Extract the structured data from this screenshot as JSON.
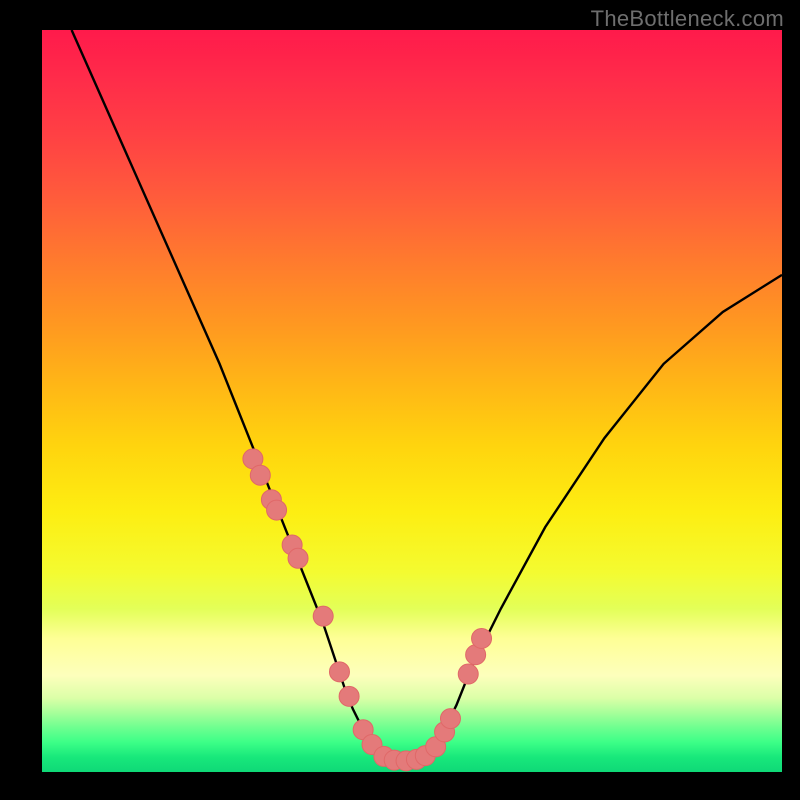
{
  "watermark": "TheBottleneck.com",
  "colors": {
    "background": "#000000",
    "curve": "#000000",
    "dots": "#e47a7a",
    "dot_stroke": "#e06868"
  },
  "chart_data": {
    "type": "line",
    "title": "",
    "xlabel": "",
    "ylabel": "",
    "xlim": [
      0,
      100
    ],
    "ylim": [
      0,
      100
    ],
    "curve": {
      "x": [
        4,
        8,
        12,
        16,
        20,
        24,
        26,
        28,
        30,
        32,
        34,
        36,
        38,
        40,
        41,
        42,
        43,
        44,
        45,
        46,
        48,
        50,
        52,
        53,
        54,
        56,
        58,
        62,
        68,
        76,
        84,
        92,
        100
      ],
      "y": [
        100,
        91,
        82,
        73,
        64,
        55,
        50,
        45,
        40,
        35,
        30,
        25,
        20,
        14,
        11,
        8.5,
        6.5,
        4.8,
        3.5,
        2.6,
        1.5,
        1.5,
        2.4,
        3.4,
        5,
        9,
        14,
        22,
        33,
        45,
        55,
        62,
        67
      ]
    },
    "series": [
      {
        "name": "dots",
        "type": "scatter",
        "x": [
          28.5,
          29.5,
          31,
          31.7,
          33.8,
          34.6,
          38,
          40.2,
          41.5,
          43.4,
          44.6,
          46.2,
          47.6,
          49.2,
          50.6,
          51.8,
          53.2,
          54.4,
          55.2,
          57.6,
          58.6,
          59.4
        ],
        "y": [
          42.2,
          40.0,
          36.7,
          35.3,
          30.6,
          28.8,
          21.0,
          13.5,
          10.2,
          5.7,
          3.7,
          2.1,
          1.6,
          1.5,
          1.7,
          2.2,
          3.4,
          5.4,
          7.2,
          13.2,
          15.8,
          18.0
        ]
      }
    ]
  }
}
